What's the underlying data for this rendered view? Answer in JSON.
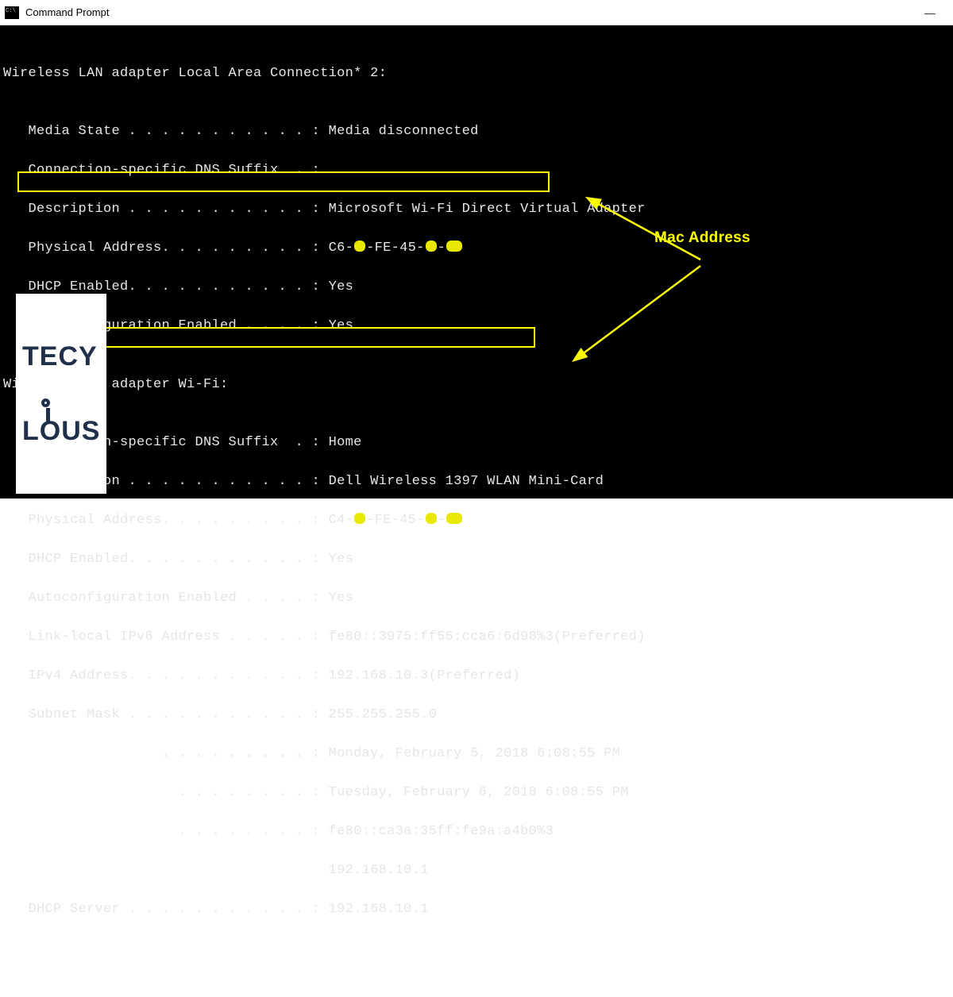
{
  "window": {
    "title": "Command Prompt",
    "minimize": "—"
  },
  "output": {
    "adapter1_header": "Wireless LAN adapter Local Area Connection* 2:",
    "blank": "",
    "a1_media": "   Media State . . . . . . . . . . . : Media disconnected",
    "a1_dnssuf": "   Connection-specific DNS Suffix  . :",
    "a1_desc": "   Description . . . . . . . . . . . : Microsoft Wi-Fi Direct Virtual Adapter",
    "a1_phys_l": "   Physical Address. . . . . . . . . : C6-",
    "a1_phys_m": "-FE-45-",
    "a1_dhcp": "   DHCP Enabled. . . . . . . . . . . : Yes",
    "a1_auto": "   Autoconfiguration Enabled . . . . : Yes",
    "adapter2_header": "Wireless LAN adapter Wi-Fi:",
    "a2_dnssuf": "   Connection-specific DNS Suffix  . : Home",
    "a2_desc": "   Description . . . . . . . . . . . : Dell Wireless 1397 WLAN Mini-Card",
    "a2_phys_l": "   Physical Address. . . . . . . . . : C4-",
    "a2_phys_m": "-FE-45-",
    "a2_dhcp": "   DHCP Enabled. . . . . . . . . . . : Yes",
    "a2_auto": "   Autoconfiguration Enabled . . . . : Yes",
    "a2_ll6": "   Link-local IPv6 Address . . . . . : fe80::3975:ff55:cca6:6d98%3(Preferred)",
    "a2_ipv4": "   IPv4 Address. . . . . . . . . . . : 192.168.10.3(Preferred)",
    "a2_mask": "   Subnet Mask . . . . . . . . . . . : 255.255.255.0",
    "a2_lease1": "                   . . . . . . . . . : Monday, February 5, 2018 6:08:55 PM",
    "a2_lease2": "                     . . . . . . . . : Tuesday, February 6, 2018 6:08:55 PM",
    "a2_gw1": "                     . . . . . . . . : fe80::ca3a:35ff:fe9a:a4b0%3",
    "a2_gw2": "                                       192.168.10.1",
    "a2_dhcpsrv": "   DHCP Server . . . . . . . . . . . : 192.168.10.1"
  },
  "annotation": {
    "label": "Mac Address"
  },
  "logo": {
    "line1": "TECY",
    "line2_a": "L",
    "line2_b": "US"
  }
}
